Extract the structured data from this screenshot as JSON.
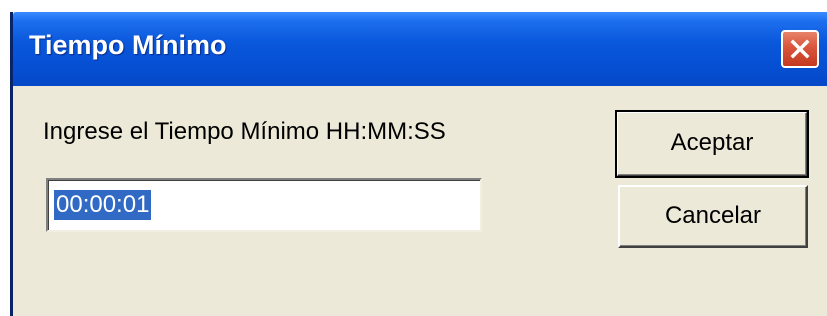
{
  "window": {
    "title": "Tiempo Mínimo",
    "close_icon": "close-icon"
  },
  "dialog": {
    "prompt": "Ingrese el Tiempo Mínimo HH:MM:SS",
    "time_value": "00:00:01",
    "accept_label": "Aceptar",
    "cancel_label": "Cancelar"
  },
  "colors": {
    "titlebar": "#0A58DB",
    "dialog_bg": "#ECE9D8",
    "close_button": "#D9553C",
    "selection": "#316AC5"
  }
}
